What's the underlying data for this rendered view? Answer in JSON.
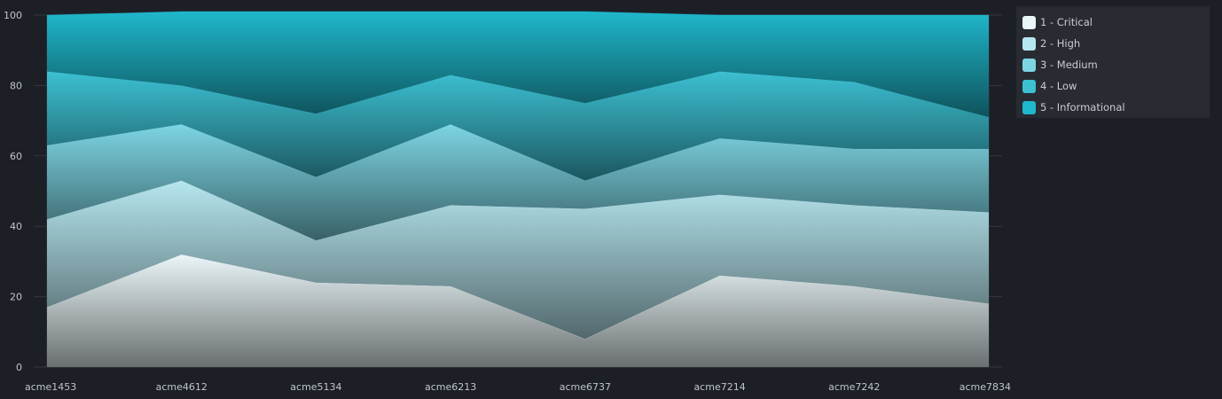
{
  "chart_data": {
    "type": "area",
    "stacked": true,
    "categories": [
      "acme1453",
      "acme4612",
      "acme5134",
      "acme6213",
      "acme6737",
      "acme7214",
      "acme7242",
      "acme7834"
    ],
    "series": [
      {
        "name": "1 - Critical",
        "color": "#eaf6f8",
        "values": [
          17,
          32,
          24,
          23,
          8,
          26,
          23,
          18
        ]
      },
      {
        "name": "2 - High",
        "color": "#b6e6ef",
        "values": [
          25,
          21,
          12,
          23,
          37,
          23,
          23,
          26
        ]
      },
      {
        "name": "3 - Medium",
        "color": "#7dd5e3",
        "values": [
          21,
          16,
          18,
          23,
          8,
          16,
          16,
          18
        ]
      },
      {
        "name": "4 - Low",
        "color": "#3cc0d2",
        "values": [
          21,
          11,
          18,
          14,
          22,
          19,
          19,
          9
        ]
      },
      {
        "name": "5 - Informational",
        "color": "#1fb7cb",
        "values": [
          16,
          21,
          29,
          18,
          26,
          16,
          19,
          29
        ]
      }
    ],
    "ylim": [
      0,
      100
    ],
    "yticks": [
      0,
      20,
      40,
      60,
      80,
      100
    ],
    "grid": true,
    "legend_position": "top-right"
  }
}
